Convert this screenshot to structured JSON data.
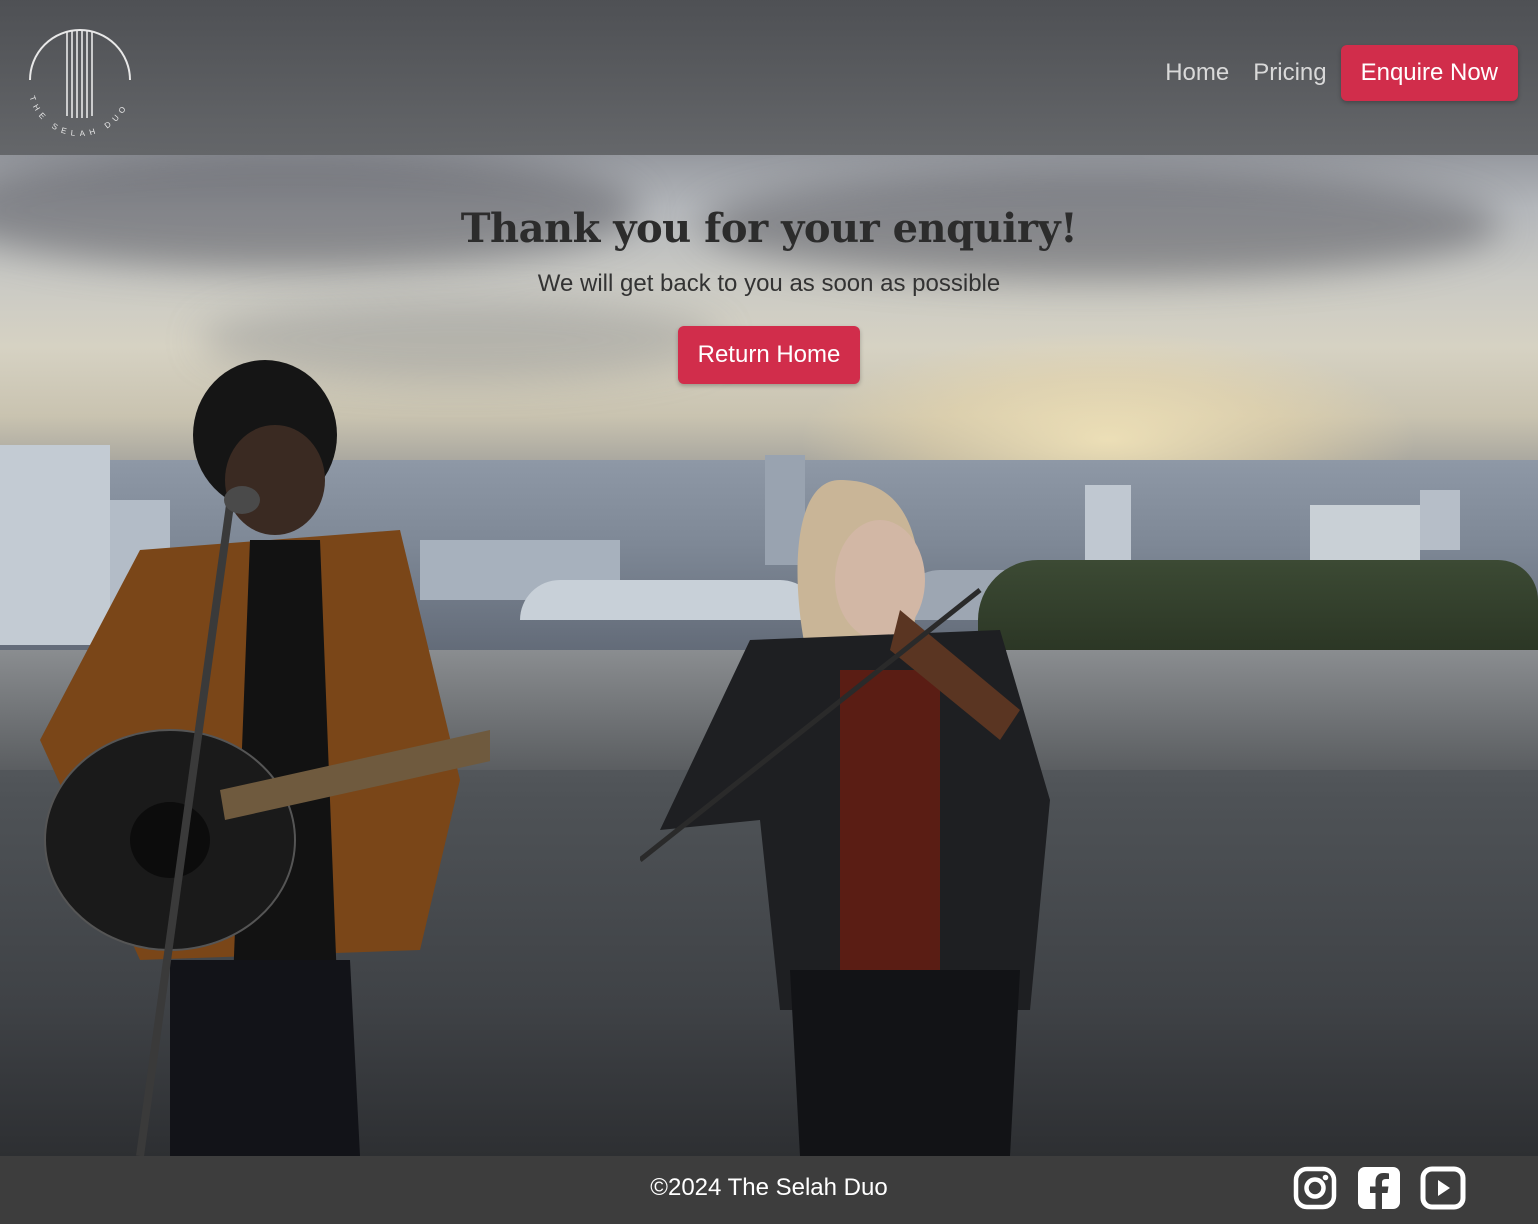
{
  "header": {
    "logo_text": "THE SELAH DUO",
    "nav": [
      {
        "label": "Home"
      },
      {
        "label": "Pricing"
      }
    ],
    "cta_label": "Enquire Now"
  },
  "main": {
    "heading": "Thank you for your enquiry!",
    "subheading": "We will get back to you as soon as possible",
    "button_label": "Return Home"
  },
  "footer": {
    "copyright": "©2024 The Selah Duo",
    "socials": [
      "instagram-icon",
      "facebook-icon",
      "youtube-icon"
    ]
  },
  "colors": {
    "accent": "#d12d4b",
    "header_bg": "#5a5c60",
    "footer_bg": "#3d3d3d"
  }
}
